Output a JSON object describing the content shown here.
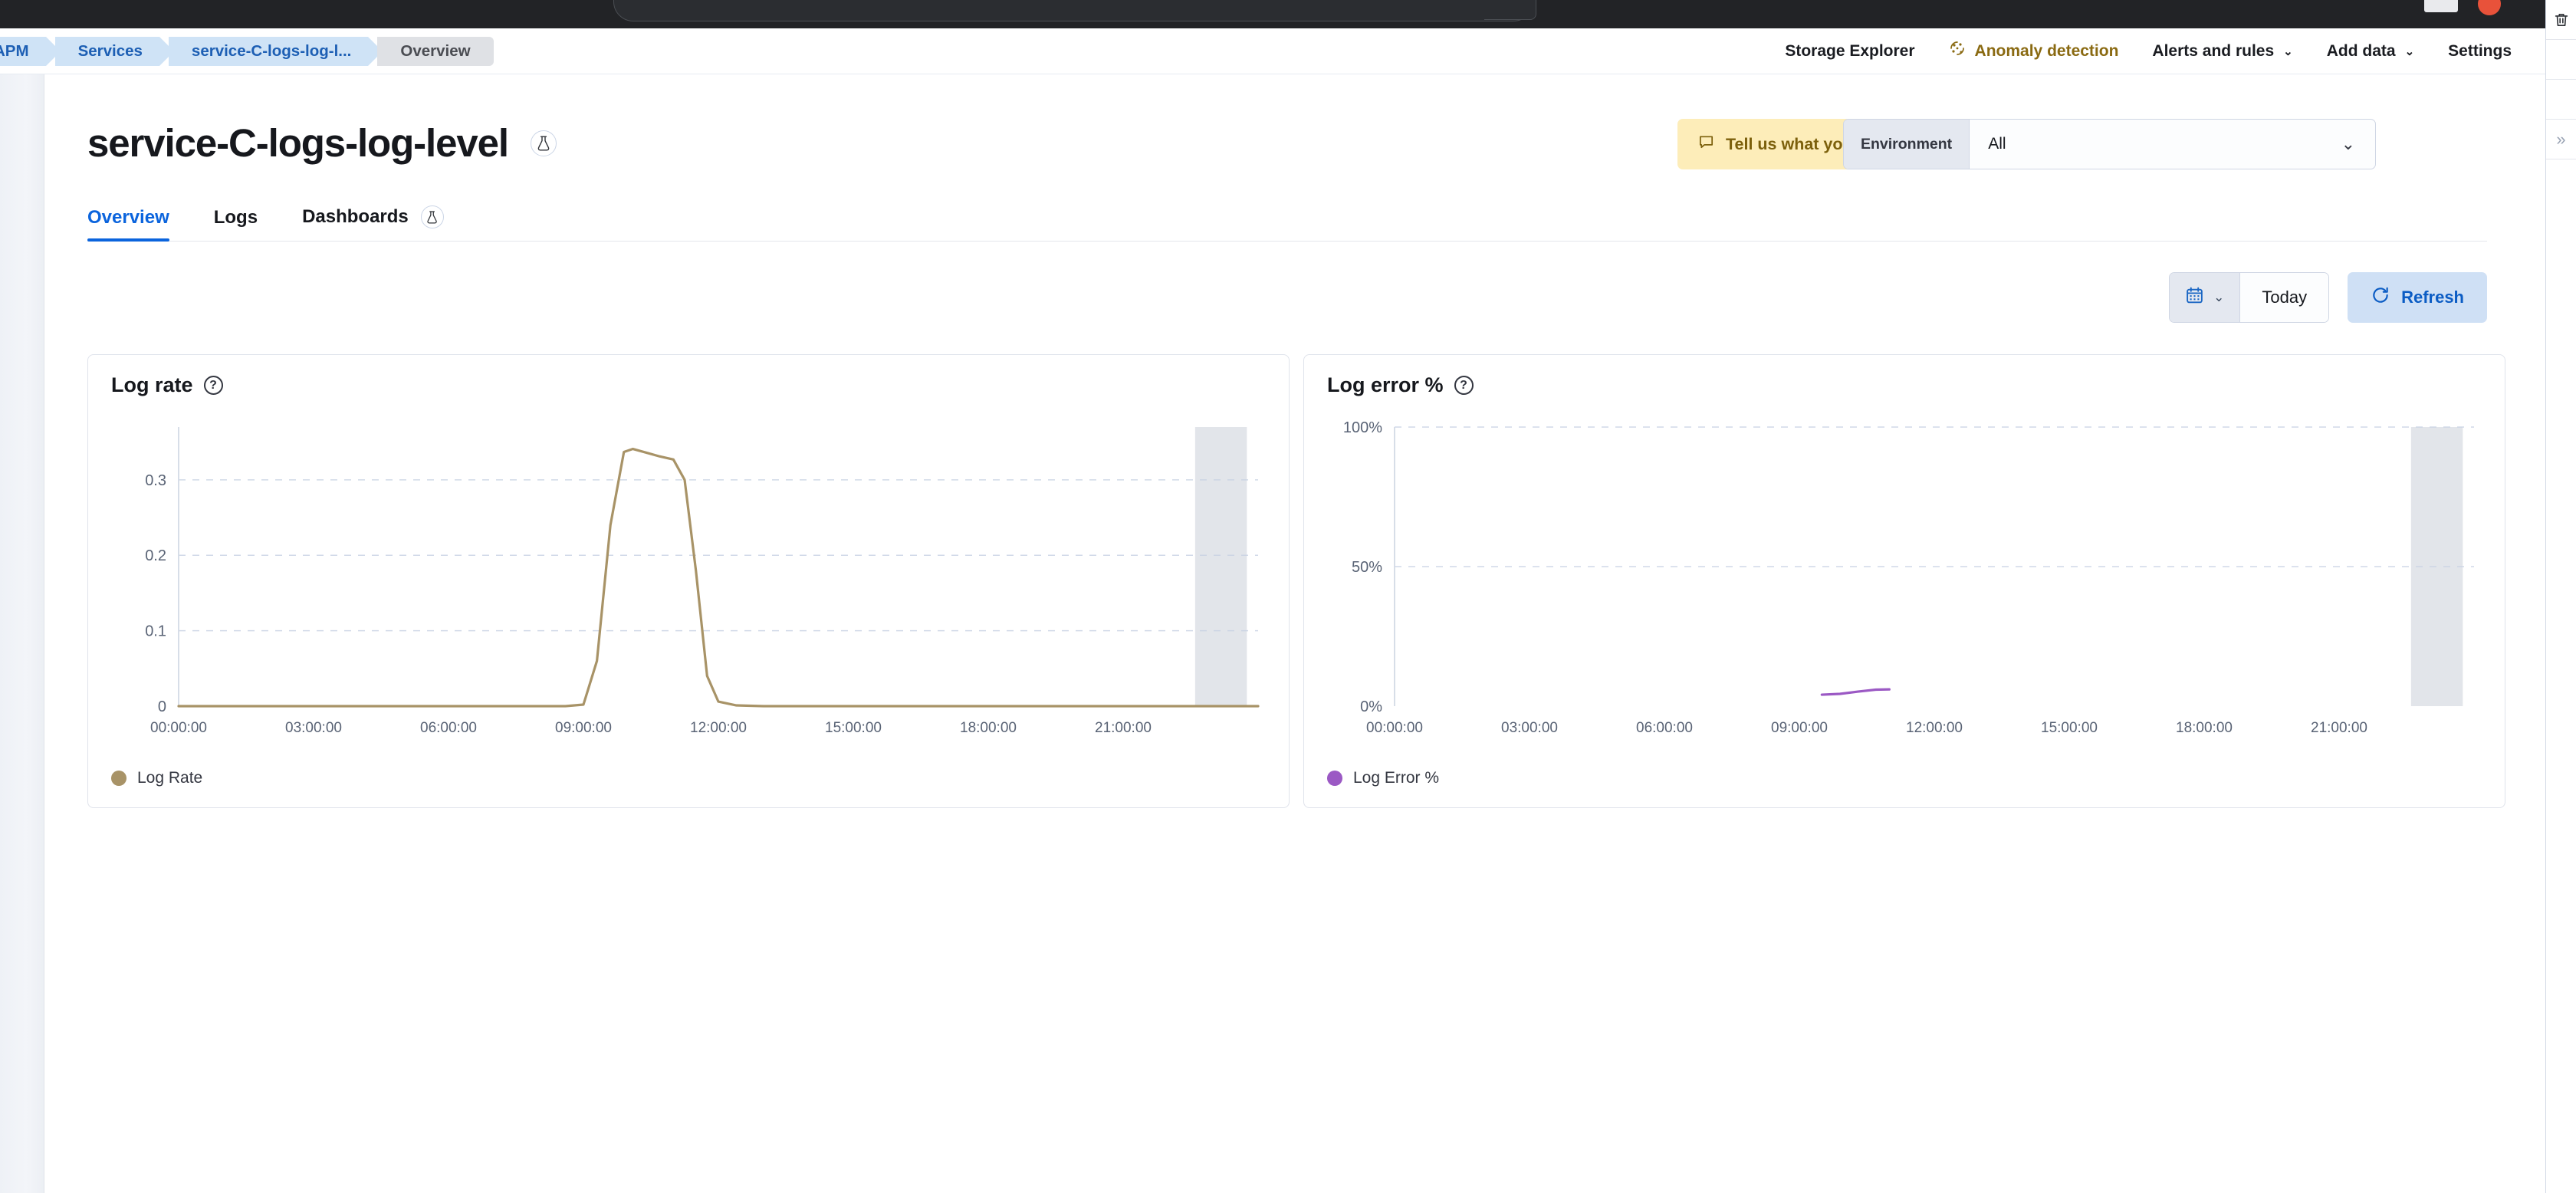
{
  "browser": {
    "omnibox_placeholder": "",
    "omnibox_value": ""
  },
  "breadcrumbs": [
    {
      "label": "APM",
      "current": false
    },
    {
      "label": "Services",
      "current": false
    },
    {
      "label": "service-C-logs-log-l...",
      "current": false
    },
    {
      "label": "Overview",
      "current": true
    }
  ],
  "topnav": [
    {
      "label": "Storage Explorer",
      "icon": null,
      "caret": false,
      "accent": false
    },
    {
      "label": "Anomaly detection",
      "icon": "anomaly-detection-icon",
      "caret": false,
      "accent": true
    },
    {
      "label": "Alerts and rules",
      "icon": null,
      "caret": true,
      "accent": false
    },
    {
      "label": "Add data",
      "icon": null,
      "caret": true,
      "accent": false
    },
    {
      "label": "Settings",
      "icon": null,
      "caret": false,
      "accent": false
    }
  ],
  "header": {
    "title": "service-C-logs-log-level",
    "title_badge_icon": "beaker-icon",
    "feedback_label": "Tell us what you think!",
    "feedback_icon": "comment-icon",
    "environment_label": "Environment",
    "environment_value": "All"
  },
  "tabs": [
    {
      "label": "Overview",
      "active": true,
      "badge": null
    },
    {
      "label": "Logs",
      "active": false,
      "badge": null
    },
    {
      "label": "Dashboards",
      "active": false,
      "badge": "beaker-icon"
    }
  ],
  "date_controls": {
    "calendar_icon": "calendar-icon",
    "caret_icon": "chevron-down-icon",
    "range_value": "Today",
    "refresh_label": "Refresh",
    "refresh_icon": "refresh-icon"
  },
  "right_rail": {
    "trash_icon": "trash-icon",
    "expand_icon": "double-chevron-right-icon"
  },
  "colors": {
    "log_rate_series": "#a89367",
    "log_error_series": "#9b59c4",
    "accent_blue": "#0b64dd",
    "feedback_bg": "#fdedb9",
    "partial_band": "#dde0e6"
  },
  "panels": [
    {
      "id": "log-rate",
      "title": "Log rate",
      "help_icon": "question-mark-icon"
    },
    {
      "id": "log-error",
      "title": "Log error %",
      "help_icon": "question-mark-icon"
    }
  ],
  "chart_data": [
    {
      "id": "log-rate",
      "type": "line",
      "title": "Log rate",
      "xlabel": "",
      "ylabel": "",
      "grid": true,
      "legend_position": "bottom-left",
      "xticks": [
        "00:00:00",
        "03:00:00",
        "06:00:00",
        "09:00:00",
        "12:00:00",
        "15:00:00",
        "18:00:00",
        "21:00:00"
      ],
      "yticks": [
        0,
        0.1,
        0.2,
        0.3
      ],
      "ytick_labels": [
        "0",
        "0.1",
        "0.2",
        "0.3"
      ],
      "ylim": [
        0,
        0.37
      ],
      "xlim_hours": [
        0,
        24
      ],
      "partial_band_hours": [
        22.6,
        23.75
      ],
      "series": [
        {
          "name": "Log Rate",
          "color": "#a89367",
          "x_hours": [
            0,
            1,
            2,
            3,
            4,
            5,
            6,
            7,
            8,
            8.6,
            9.0,
            9.3,
            9.6,
            9.9,
            10.1,
            10.4,
            10.7,
            11.0,
            11.25,
            11.5,
            11.75,
            12,
            12.4,
            13,
            14,
            15,
            16,
            17,
            18,
            19,
            20,
            21,
            22,
            23,
            24
          ],
          "values": [
            0,
            0,
            0,
            0,
            0,
            0,
            0,
            0,
            0,
            0,
            0.002,
            0.06,
            0.24,
            0.337,
            0.341,
            0.336,
            0.331,
            0.327,
            0.3,
            0.18,
            0.04,
            0.006,
            0.001,
            0,
            0,
            0,
            0,
            0,
            0,
            0,
            0,
            0,
            0,
            0,
            0
          ]
        }
      ]
    },
    {
      "id": "log-error",
      "type": "line",
      "title": "Log error %",
      "xlabel": "",
      "ylabel": "",
      "grid": true,
      "legend_position": "bottom-left",
      "xticks": [
        "00:00:00",
        "03:00:00",
        "06:00:00",
        "09:00:00",
        "12:00:00",
        "15:00:00",
        "18:00:00",
        "21:00:00"
      ],
      "yticks": [
        0,
        50,
        100
      ],
      "ytick_labels": [
        "0%",
        "50%",
        "100%"
      ],
      "ylim": [
        0,
        100
      ],
      "xlim_hours": [
        0,
        24
      ],
      "partial_band_hours": [
        22.6,
        23.75
      ],
      "series": [
        {
          "name": "Log Error %",
          "color": "#9b59c4",
          "x_hours": [
            9.5,
            9.9,
            10.3,
            10.7,
            11.0
          ],
          "values": [
            4.1,
            4.4,
            5.2,
            5.9,
            6.0
          ]
        }
      ]
    }
  ],
  "legends": [
    {
      "panel": "log-rate",
      "label": "Log Rate",
      "color": "#a89367"
    },
    {
      "panel": "log-error",
      "label": "Log Error %",
      "color": "#9b59c4"
    }
  ]
}
